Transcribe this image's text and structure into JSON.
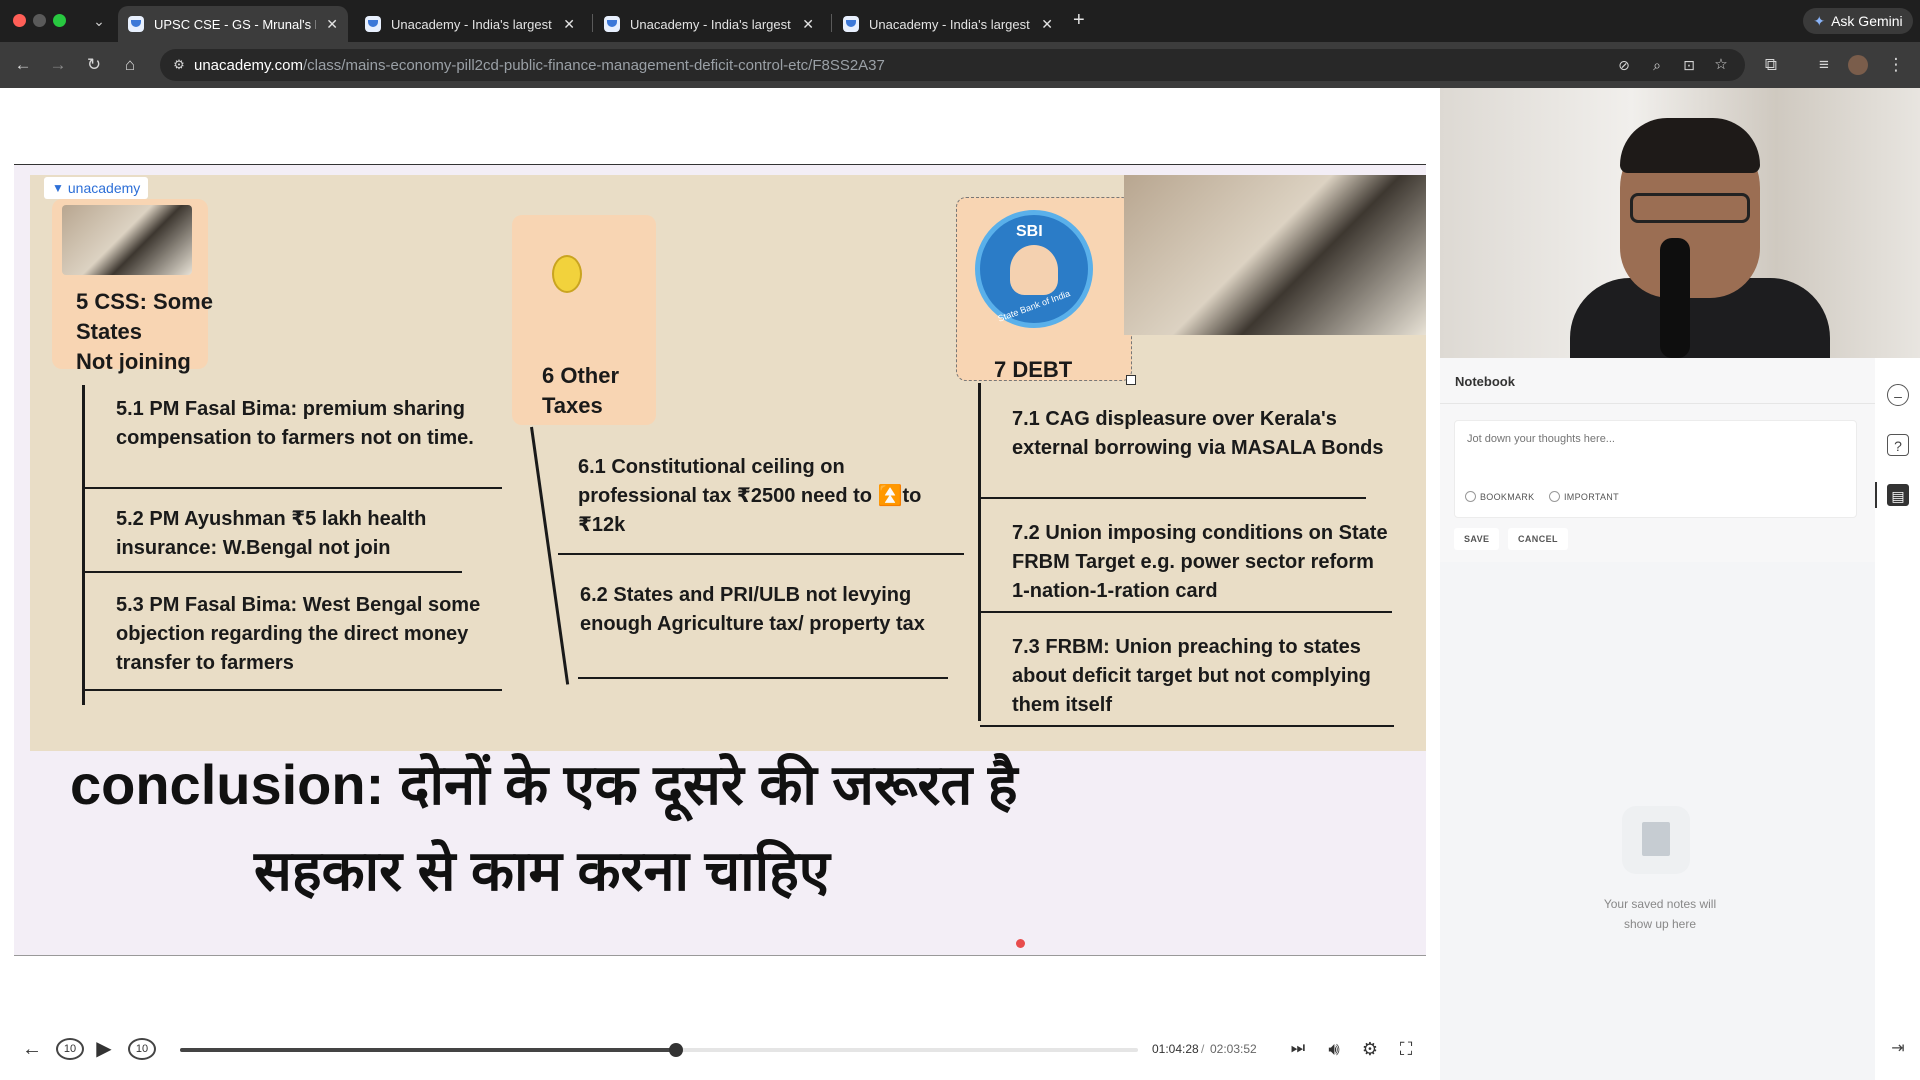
{
  "browser": {
    "tabs": [
      {
        "title": "UPSC CSE - GS - Mrunal's Ec",
        "active": true
      },
      {
        "title": "Unacademy - India's largest l",
        "active": false
      },
      {
        "title": "Unacademy - India's largest l",
        "active": false
      },
      {
        "title": "Unacademy - India's largest l",
        "active": false
      }
    ],
    "ask_gemini": "Ask Gemini",
    "url_host": "unacademy.com",
    "url_path": "/class/mains-economy-pill2cd-public-finance-management-deficit-control-etc/F8SS2A37"
  },
  "slide": {
    "brand": "unacademy",
    "col1": {
      "heading": [
        "5 CSS: Some",
        "States",
        "Not joining"
      ],
      "points": [
        "5.1 PM Fasal Bima: premium sharing compensation to farmers not on time.",
        "5.2 PM Ayushman ₹5 lakh health insurance: W.Bengal not join",
        "5.3 PM Fasal Bima: West Bengal some objection regarding the direct money transfer to farmers"
      ]
    },
    "col2": {
      "heading": [
        "6 Other",
        "Taxes"
      ],
      "points": [
        "6.1 Constitutional ceiling on professional tax ₹2500 need to ⏫to ₹12k",
        "6.2 States and PRI/ULB not levying enough Agriculture tax/ property tax"
      ]
    },
    "col3": {
      "sbi_label": "SBI",
      "sbi_ring": "State Bank of India",
      "heading": "7 DEBT",
      "points": [
        "7.1 CAG displeasure over Kerala's external borrowing via MASALA Bonds",
        "7.2 Union imposing conditions on State FRBM Target e.g. power sector reform 1-nation-1-ration card",
        "7.3 FRBM: Union preaching to states about deficit target but not complying them itself"
      ]
    },
    "conclusion_1": "conclusion: दोनों के एक दूसरे की जरूरत है",
    "conclusion_2": "सहकार से काम करना चाहिए"
  },
  "player": {
    "current_time": "01:04:28",
    "separator": "/",
    "total_time": "02:03:52",
    "progress": 0.518,
    "skip_back": "10",
    "skip_forward": "10"
  },
  "notebook": {
    "title": "Notebook",
    "placeholder": "Jot down your thoughts here...",
    "bookmark": "BOOKMARK",
    "important": "IMPORTANT",
    "save": "SAVE",
    "cancel": "CANCEL",
    "empty_line1": "Your saved notes will",
    "empty_line2": "show up here"
  },
  "colors": {
    "slide_bg": "#e9ddc6",
    "card": "#f8d5b3",
    "brand": "#2d6fd7"
  }
}
